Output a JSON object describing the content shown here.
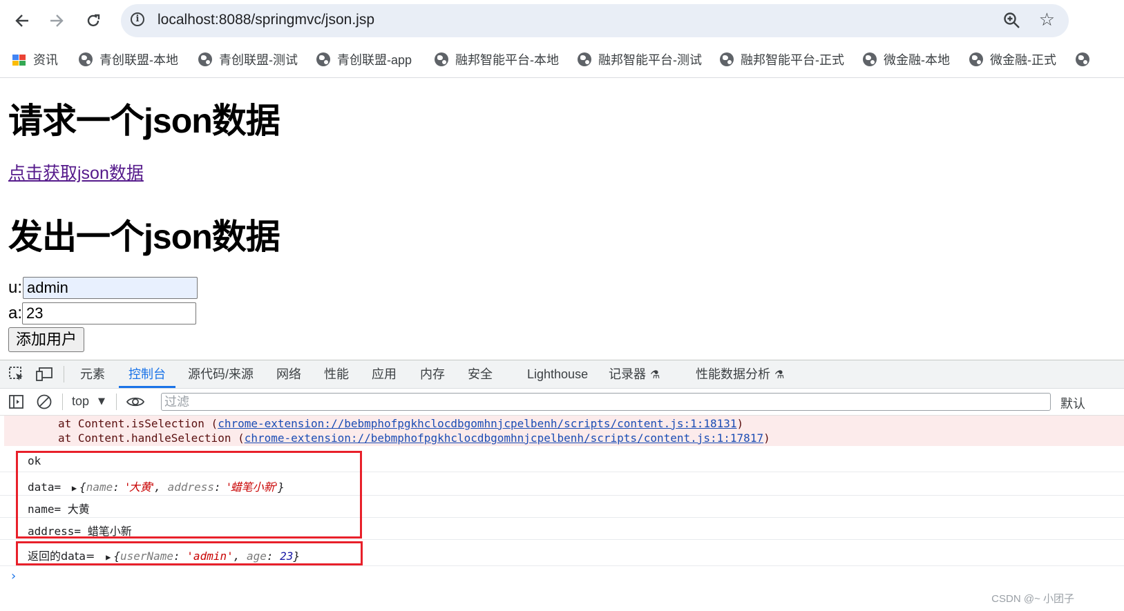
{
  "browser": {
    "url": "localhost:8088/springmvc/json.jsp",
    "bookmarks": [
      {
        "label": "资讯",
        "icon": "news-icon"
      },
      {
        "label": "青创联盟-本地",
        "icon": "globe-icon"
      },
      {
        "label": "青创联盟-测试",
        "icon": "globe-icon"
      },
      {
        "label": "青创联盟-app",
        "icon": "globe-icon"
      },
      {
        "label": "融邦智能平台-本地",
        "icon": "globe-icon"
      },
      {
        "label": "融邦智能平台-测试",
        "icon": "globe-icon"
      },
      {
        "label": "融邦智能平台-正式",
        "icon": "globe-icon"
      },
      {
        "label": "微金融-本地",
        "icon": "globe-icon"
      },
      {
        "label": "微金融-正式",
        "icon": "globe-icon"
      }
    ]
  },
  "page": {
    "heading_get": "请求一个json数据",
    "link_get": "点击获取json数据",
    "heading_post": "发出一个json数据",
    "label_u": "u:",
    "input_u_value": "admin",
    "label_a": "a:",
    "input_a_value": "23",
    "submit_label": "添加用户"
  },
  "devtools": {
    "tabs": [
      "元素",
      "控制台",
      "源代码/来源",
      "网络",
      "性能",
      "应用",
      "内存",
      "安全",
      "Lighthouse",
      "记录器",
      "性能数据分析"
    ],
    "active_tab": "控制台",
    "context": "top",
    "filter_placeholder": "过滤",
    "levels_label": "默认",
    "errors": [
      {
        "prefix": "at Content.isSelection (",
        "link": "chrome-extension://bebmphofpgkhclocdbgomhnjcpelbenh/scripts/content.js:1:18131",
        "suffix": ")"
      },
      {
        "prefix": "at Content.handleSelection (",
        "link": "chrome-extension://bebmphofpgkhclocdbgomhnjcpelbenh/scripts/content.js:1:17817",
        "suffix": ")"
      }
    ],
    "logs": {
      "ok": "ok",
      "data_label": "data=",
      "data_obj": {
        "k1": "name",
        "v1": "'大黄'",
        "k2": "address",
        "v2": "'蜡笔小新'"
      },
      "name_line": "name= 大黄",
      "address_line": "address= 蜡笔小新",
      "return_label": "返回的data=",
      "return_obj": {
        "k1": "userName",
        "v1": "'admin'",
        "k2": "age",
        "v2": "23"
      }
    },
    "prompt": "›"
  },
  "watermark": "CSDN @~ 小团子",
  "colors": {
    "highlight_box": "#e8202a",
    "link": "#551a8b",
    "accent": "#1a73e8"
  }
}
